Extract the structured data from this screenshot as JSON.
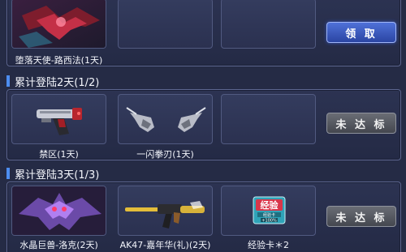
{
  "day1": {
    "items": [
      {
        "label": "堕落天使-路西法(1天)"
      }
    ],
    "claim_button": "领 取"
  },
  "day2": {
    "title": "累计登陆2天(1/2)",
    "items": [
      {
        "label": "禁区(1天)"
      },
      {
        "label": "一闪拳刃(1天)"
      }
    ],
    "status_button": "未 达 标"
  },
  "day3": {
    "title": "累计登陆3天(1/3)",
    "items": [
      {
        "label": "水晶巨兽-洛克(2天)"
      },
      {
        "label": "AK47-嘉年华(礼)(2天)"
      },
      {
        "label": "经验卡＊2"
      }
    ],
    "exp_card": {
      "title": "经验",
      "subtitle": "经验卡",
      "bonus": "+100%"
    },
    "status_button": "未 达 标"
  },
  "colors": {
    "accent_blue": "#4d8df0",
    "claim_button": "#3b5bc4",
    "disabled_button": "#55585f"
  }
}
